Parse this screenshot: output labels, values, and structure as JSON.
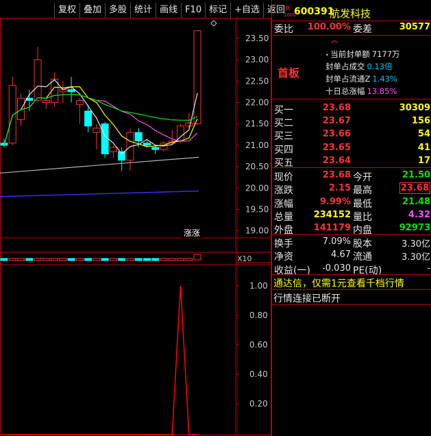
{
  "toolbar": [
    "复权",
    "叠加",
    "多股",
    "统计",
    "画线",
    "F10",
    "标记",
    "+自选",
    "返回"
  ],
  "chart_data": [
    {
      "type": "candlestick",
      "y_ticks": [
        23.5,
        23.0,
        22.5,
        22.0,
        21.5,
        21.0,
        20.5,
        20.0,
        19.5,
        19.0
      ],
      "ylim": [
        18.85,
        23.9
      ],
      "candles": [
        {
          "o": 21.05,
          "c": 21.0,
          "h": 21.15,
          "l": 20.95
        },
        {
          "o": 21.05,
          "c": 22.4,
          "h": 22.6,
          "l": 21.0
        },
        {
          "o": 21.6,
          "c": 22.1,
          "h": 22.2,
          "l": 21.45
        },
        {
          "o": 22.1,
          "c": 22.05,
          "h": 22.3,
          "l": 21.8
        },
        {
          "o": 22.05,
          "c": 23.0,
          "h": 23.3,
          "l": 22.0
        },
        {
          "o": 22.0,
          "c": 22.05,
          "h": 22.1,
          "l": 21.85
        },
        {
          "o": 22.0,
          "c": 22.55,
          "h": 22.7,
          "l": 21.9
        },
        {
          "o": 22.25,
          "c": 22.3,
          "h": 22.5,
          "l": 22.0
        },
        {
          "o": 22.3,
          "c": 22.25,
          "h": 22.6,
          "l": 22.0
        },
        {
          "o": 21.95,
          "c": 22.05,
          "h": 22.1,
          "l": 21.5
        },
        {
          "o": 21.8,
          "c": 21.45,
          "h": 21.95,
          "l": 21.3
        },
        {
          "o": 21.3,
          "c": 21.4,
          "h": 21.5,
          "l": 20.9
        },
        {
          "o": 21.5,
          "c": 20.8,
          "h": 21.55,
          "l": 20.7
        },
        {
          "o": 20.85,
          "c": 20.95,
          "h": 21.0,
          "l": 20.7
        },
        {
          "o": 20.85,
          "c": 20.65,
          "h": 20.95,
          "l": 20.4
        },
        {
          "o": 20.65,
          "c": 21.3,
          "h": 21.4,
          "l": 20.4
        },
        {
          "o": 21.3,
          "c": 21.1,
          "h": 21.4,
          "l": 20.95
        },
        {
          "o": 21.05,
          "c": 21.0,
          "h": 21.1,
          "l": 20.95
        },
        {
          "o": 20.95,
          "c": 20.9,
          "h": 21.0,
          "l": 20.8
        },
        {
          "o": 20.9,
          "c": 21.05,
          "h": 21.1,
          "l": 20.85
        },
        {
          "o": 21.05,
          "c": 21.1,
          "h": 21.35,
          "l": 21.0
        },
        {
          "o": 21.1,
          "c": 21.45,
          "h": 21.5,
          "l": 21.05
        },
        {
          "o": 21.45,
          "c": 21.52,
          "h": 21.75,
          "l": 21.4
        },
        {
          "o": 21.5,
          "c": 23.68,
          "h": 23.68,
          "l": 21.48
        }
      ],
      "annotation": "涨涨",
      "sub_label": "X10"
    },
    {
      "type": "line",
      "y_ticks": [
        1.0,
        0.8,
        0.6,
        0.4,
        0.2
      ],
      "ylim": [
        0,
        1.12
      ],
      "values": [
        0,
        0,
        0,
        0,
        0,
        0,
        0,
        0,
        0,
        0,
        0,
        0,
        0,
        0,
        0,
        0,
        0,
        0,
        0,
        0,
        0,
        1.0,
        0,
        0
      ]
    }
  ],
  "stock": {
    "code": "600391",
    "name": "航发科技",
    "badge": "R",
    "badge_sub": "1000"
  },
  "weibi": {
    "label": "委比",
    "value": "100.00%",
    "label2": "委差",
    "value2": "30577"
  },
  "seal": {
    "title": "首板",
    "lines": [
      {
        "label": "当前封单额",
        "value": "7177万"
      },
      {
        "label": "封单占成交",
        "value": "0.13倍"
      },
      {
        "label": "封单占流通Z",
        "value": "1.43%"
      },
      {
        "label": "十日总涨幅",
        "value": "13.85%"
      }
    ]
  },
  "bids": [
    {
      "label": "买一",
      "price": "23.68",
      "vol": "30309"
    },
    {
      "label": "买二",
      "price": "23.67",
      "vol": "156"
    },
    {
      "label": "买三",
      "price": "23.66",
      "vol": "54"
    },
    {
      "label": "买四",
      "price": "23.65",
      "vol": "41"
    },
    {
      "label": "买五",
      "price": "23.64",
      "vol": "17"
    }
  ],
  "quote": [
    {
      "l1": "现价",
      "v1": "23.68",
      "l2": "今开",
      "v2": "21.50"
    },
    {
      "l1": "涨跌",
      "v1": "2.15",
      "l2": "最高",
      "v2": "23.68"
    },
    {
      "l1": "涨幅",
      "v1": "9.99%",
      "l2": "最低",
      "v2": "21.48"
    },
    {
      "l1": "总量",
      "v1": "234152",
      "l2": "量比",
      "v2": "4.32"
    },
    {
      "l1": "外盘",
      "v1": "141179",
      "l2": "内盘",
      "v2": "92973"
    }
  ],
  "fund": [
    {
      "l1": "换手",
      "v1": "7.09%",
      "l2": "股本",
      "v2": "3.30亿"
    },
    {
      "l1": "净资",
      "v1": "4.67",
      "l2": "流通",
      "v2": "3.30亿"
    },
    {
      "l1": "收益(一)",
      "v1": "-0.030",
      "l2": "PE(动)",
      "v2": "-"
    }
  ],
  "ads": {
    "line1": "通达信，仅需1元查看千档行情",
    "line2": "行情连接已断开"
  },
  "colors": {
    "up": "#ff3232",
    "down": "#00ffff",
    "border": "#c00000",
    "bg": "#000000"
  }
}
